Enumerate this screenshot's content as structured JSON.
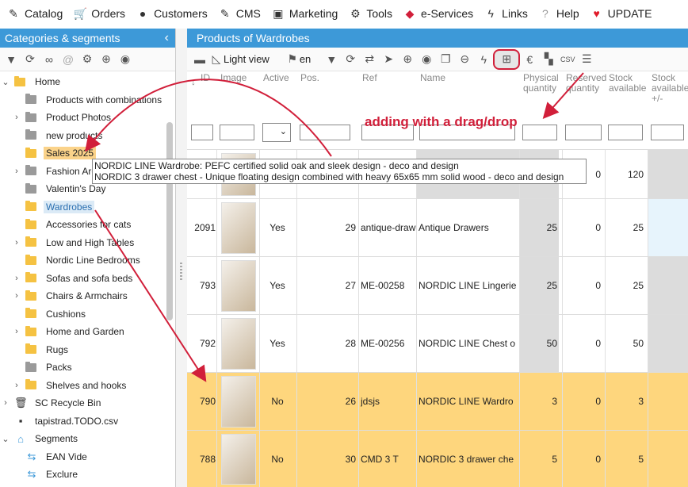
{
  "menu": [
    {
      "label": "Catalog",
      "icon": "pencil-icon"
    },
    {
      "label": "Orders",
      "icon": "cart-icon"
    },
    {
      "label": "Customers",
      "icon": "user-icon"
    },
    {
      "label": "CMS",
      "icon": "pencil-icon"
    },
    {
      "label": "Marketing",
      "icon": "money-icon"
    },
    {
      "label": "Tools",
      "icon": "gear-icon"
    },
    {
      "label": "e-Services",
      "icon": "gem-icon"
    },
    {
      "label": "Links",
      "icon": "bolt-icon"
    },
    {
      "label": "Help",
      "icon": "question-icon"
    },
    {
      "label": "UPDATE",
      "icon": "heart-icon"
    }
  ],
  "left": {
    "title": "Categories & segments",
    "tree": [
      {
        "label": "Home",
        "folder": "y",
        "tog": "v",
        "indent": 0
      },
      {
        "label": "Products with combinations",
        "folder": "g",
        "tog": "",
        "indent": 1
      },
      {
        "label": "Product Photos",
        "folder": "g",
        "tog": ">",
        "indent": 1
      },
      {
        "label": "new products",
        "folder": "g",
        "tog": "",
        "indent": 1
      },
      {
        "label": "Sales 2025",
        "folder": "y",
        "tog": "",
        "indent": 1,
        "hl": "hl1"
      },
      {
        "label": "Fashion Area",
        "folder": "g",
        "tog": ">",
        "indent": 1
      },
      {
        "label": "Valentin's Day",
        "folder": "g",
        "tog": "",
        "indent": 1
      },
      {
        "label": "Wardrobes",
        "folder": "y",
        "tog": "",
        "indent": 1,
        "hl": "hl2"
      },
      {
        "label": "Accessories for cats",
        "folder": "y",
        "tog": "",
        "indent": 1
      },
      {
        "label": "Low and High Tables",
        "folder": "y",
        "tog": ">",
        "indent": 1
      },
      {
        "label": "Nordic Line Bedrooms",
        "folder": "y",
        "tog": "",
        "indent": 1
      },
      {
        "label": "Sofas and sofa beds",
        "folder": "y",
        "tog": ">",
        "indent": 1
      },
      {
        "label": "Chairs & Armchairs",
        "folder": "y",
        "tog": ">",
        "indent": 1
      },
      {
        "label": "Cushions",
        "folder": "y",
        "tog": "",
        "indent": 1
      },
      {
        "label": "Home and Garden",
        "folder": "y",
        "tog": ">",
        "indent": 1
      },
      {
        "label": "Rugs",
        "folder": "y",
        "tog": "",
        "indent": 1
      },
      {
        "label": "Packs",
        "folder": "g",
        "tog": "",
        "indent": 1
      },
      {
        "label": "Shelves and hooks",
        "folder": "y",
        "tog": ">",
        "indent": 1
      },
      {
        "label": "SC Recycle Bin",
        "folder": "bin",
        "tog": ">",
        "indent": 0
      },
      {
        "label": "tapistrad.TODO.csv",
        "folder": "file",
        "tog": "",
        "indent": 0
      },
      {
        "label": "Segments",
        "folder": "seg",
        "tog": "v",
        "indent": 0
      },
      {
        "label": "EAN Vide",
        "folder": "sync",
        "tog": "",
        "indent": 1
      },
      {
        "label": "Exclure",
        "folder": "sync",
        "tog": "",
        "indent": 1
      }
    ]
  },
  "right": {
    "title": "Products of Wardrobes",
    "view": "Light view",
    "lang": "en",
    "columns": [
      "ID",
      "Image",
      "Active",
      "Pos.",
      "Ref",
      "Name",
      "Physical quantity",
      "Reserved quantity",
      "Stock available",
      "Stock available +/-"
    ],
    "annotation": "adding with a drag/drop",
    "tooltip_lines": [
      "NORDIC LINE Wardrobe: PEFC certified solid oak and sleek design - deco and design",
      "NORDIC 3 drawer chest - Unique floating design combined with heavy 65x65 mm solid wood - deco and design"
    ],
    "rows": [
      {
        "id": "",
        "active": "",
        "pos": "",
        "ref": "",
        "name": "",
        "phys": "",
        "res": "0",
        "stock": "120",
        "sel": false
      },
      {
        "id": "2091",
        "active": "Yes",
        "pos": "29",
        "ref": "antique-draw",
        "name": "Antique Drawers",
        "phys": "25",
        "res": "0",
        "stock": "25",
        "sel": false
      },
      {
        "id": "793",
        "active": "Yes",
        "pos": "27",
        "ref": "ME-00258",
        "name": "NORDIC LINE Lingerie",
        "phys": "25",
        "res": "0",
        "stock": "25",
        "sel": false
      },
      {
        "id": "792",
        "active": "Yes",
        "pos": "28",
        "ref": "ME-00256",
        "name": "NORDIC LINE Chest o",
        "phys": "50",
        "res": "0",
        "stock": "50",
        "sel": false
      },
      {
        "id": "790",
        "active": "No",
        "pos": "26",
        "ref": "jdsjs",
        "name": "NORDIC LINE Wardro",
        "phys": "3",
        "res": "0",
        "stock": "3",
        "sel": true
      },
      {
        "id": "788",
        "active": "No",
        "pos": "30",
        "ref": "CMD 3 T",
        "name": "NORDIC 3 drawer che",
        "phys": "5",
        "res": "0",
        "stock": "5",
        "sel": true
      }
    ]
  }
}
